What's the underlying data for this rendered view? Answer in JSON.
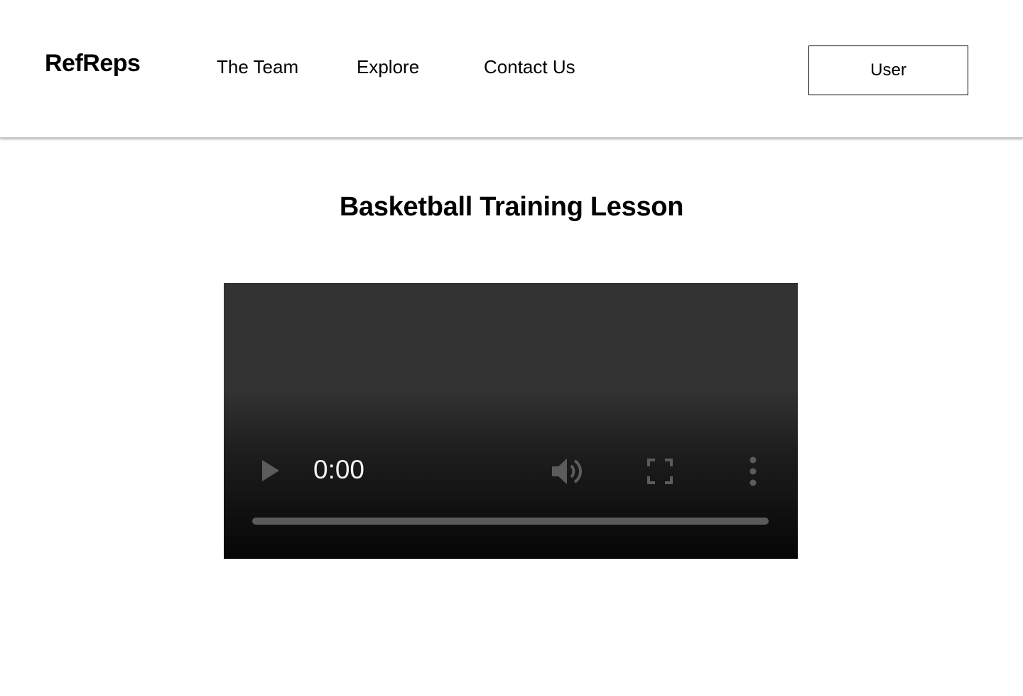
{
  "header": {
    "logo": "RefReps",
    "nav": [
      {
        "label": "The Team"
      },
      {
        "label": "Explore"
      },
      {
        "label": "Contact Us"
      }
    ],
    "user_button": "User"
  },
  "main": {
    "title": "Basketball Training Lesson",
    "video": {
      "time": "0:00",
      "progress": 0,
      "icons": {
        "play": "play-icon",
        "volume": "volume-icon",
        "fullscreen": "fullscreen-icon",
        "more": "more-vertical-icon"
      },
      "colors": {
        "controls": "#5c5c5c",
        "time_text": "#f2f2f2",
        "track": "#5a5a5a"
      }
    }
  }
}
